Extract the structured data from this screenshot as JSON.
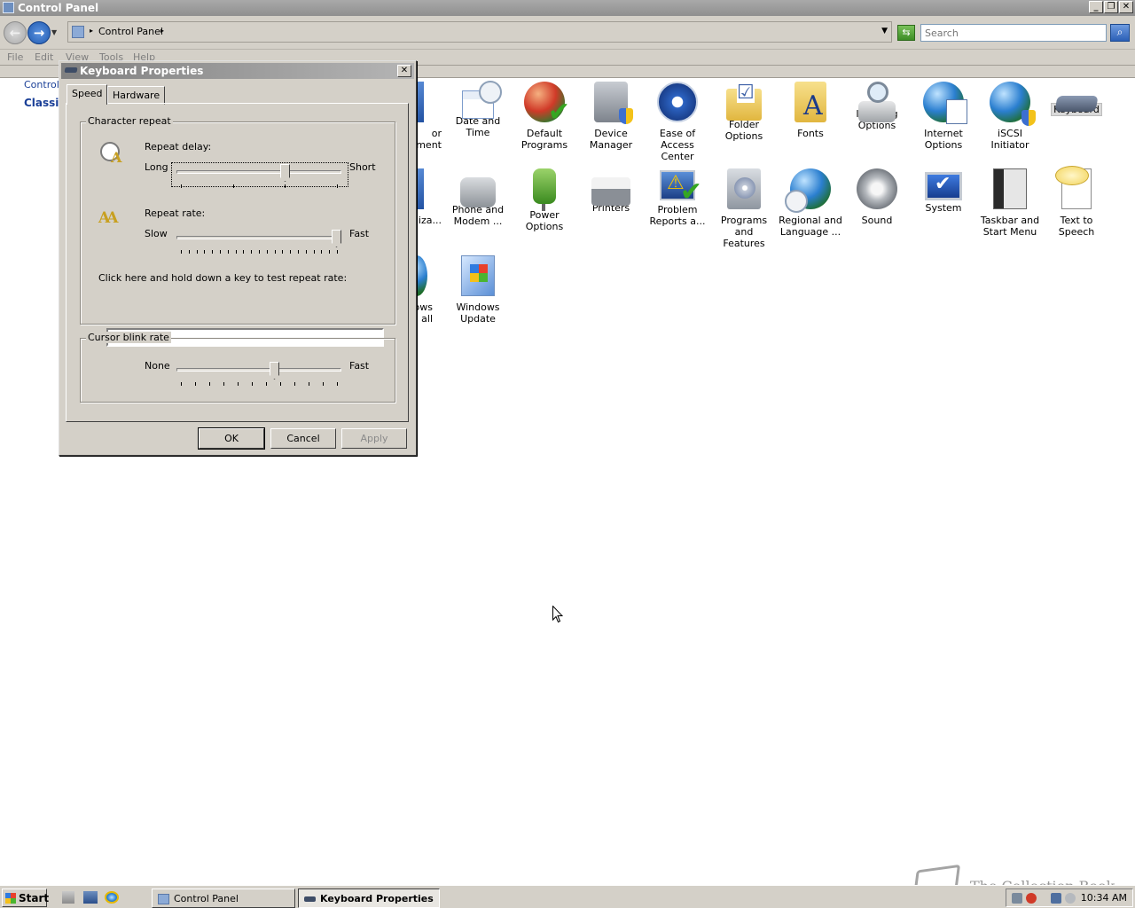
{
  "window": {
    "title": "Control Panel",
    "minimize_glyph": "_",
    "restore_glyph": "❐",
    "close_glyph": "✕"
  },
  "address": {
    "location": "Control Panel",
    "search_placeholder": "Search"
  },
  "menu": [
    "File",
    "Edit",
    "View",
    "Tools",
    "Help"
  ],
  "left_nav": {
    "home_link": "Control",
    "classic_link": "Classic"
  },
  "items": [
    {
      "label": "or\nement",
      "icon": "display-icon"
    },
    {
      "label": "Date and Time",
      "icon": "calendar-clock-icon"
    },
    {
      "label": "Default\nPrograms",
      "icon": "default-programs-icon"
    },
    {
      "label": "Device\nManager",
      "icon": "device-manager-icon"
    },
    {
      "label": "Ease of\nAccess Center",
      "icon": "ease-of-access-icon"
    },
    {
      "label": "Folder Options",
      "icon": "folder-options-icon"
    },
    {
      "label": "Fonts",
      "icon": "fonts-folder-icon"
    },
    {
      "label": "Indexing\nOptions",
      "icon": "indexing-icon"
    },
    {
      "label": "Internet\nOptions",
      "icon": "internet-options-icon"
    },
    {
      "label": "iSCSI Initiator",
      "icon": "iscsi-icon"
    },
    {
      "label": "Keyboard",
      "icon": "keyboard-icon"
    },
    {
      "label": "liza...",
      "icon": "personalization-icon"
    },
    {
      "label": "Phone and\nModem ...",
      "icon": "phone-modem-icon"
    },
    {
      "label": "Power Options",
      "icon": "power-icon"
    },
    {
      "label": "Printers",
      "icon": "printer-icon"
    },
    {
      "label": "Problem\nReports a...",
      "icon": "problem-reports-icon"
    },
    {
      "label": "Programs and\nFeatures",
      "icon": "programs-icon"
    },
    {
      "label": "Regional and\nLanguage ...",
      "icon": "regional-icon"
    },
    {
      "label": "Sound",
      "icon": "speaker-icon"
    },
    {
      "label": "System",
      "icon": "system-icon"
    },
    {
      "label": "Taskbar and\nStart Menu",
      "icon": "taskbar-icon"
    },
    {
      "label": "Text to\nSpeech",
      "icon": "speech-icon"
    },
    {
      "label": "ows\nall",
      "icon": "firewall-icon"
    },
    {
      "label": "Windows\nUpdate",
      "icon": "windows-update-icon"
    }
  ],
  "dialog": {
    "title": "Keyboard Properties",
    "tabs": [
      "Speed",
      "Hardware"
    ],
    "char_repeat_group": "Character repeat",
    "repeat_delay_label": "Repeat delay:",
    "repeat_delay_min": "Long",
    "repeat_delay_max": "Short",
    "repeat_delay_value": 0.67,
    "repeat_rate_label": "Repeat rate:",
    "repeat_rate_min": "Slow",
    "repeat_rate_max": "Fast",
    "repeat_rate_value": 1.0,
    "test_label": "Click here and hold down a key to test repeat rate:",
    "test_value": "",
    "cursor_group": "Cursor blink rate",
    "cursor_min": "None",
    "cursor_max": "Fast",
    "cursor_value": 0.6,
    "ok": "OK",
    "cancel": "Cancel",
    "apply": "Apply"
  },
  "taskbar": {
    "start": "Start",
    "tasks": [
      "Control Panel",
      "Keyboard Properties"
    ],
    "clock": "10:34 AM"
  },
  "watermark": "The Collection Book"
}
